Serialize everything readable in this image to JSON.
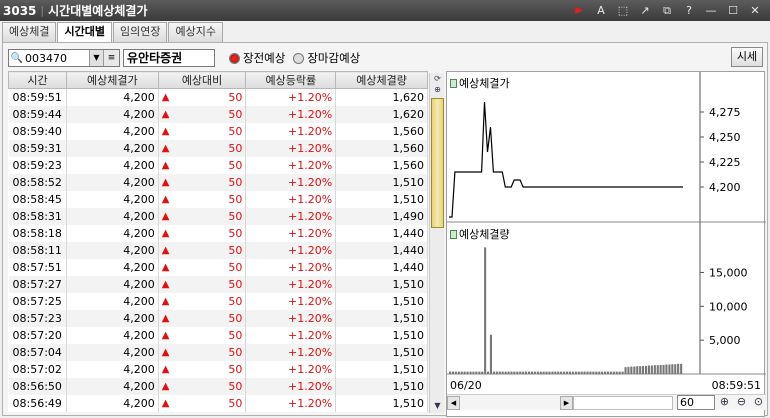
{
  "window": {
    "code": "3035",
    "title": "시간대별예상체결가"
  },
  "title_icons": [
    "play-icon",
    "font-icon",
    "pin-icon",
    "link-icon",
    "copy-icon",
    "help-icon",
    "minimize-icon",
    "maximize-icon",
    "close-icon"
  ],
  "title_icon_glyphs": [
    "▶",
    "A",
    "⬚",
    "↗",
    "⧉",
    "?",
    "—",
    "☐",
    "✕"
  ],
  "tabs": [
    "예상체결",
    "시간대별",
    "임의연장",
    "예상지수"
  ],
  "active_tab": 1,
  "controls": {
    "code_value": "003470",
    "stock_name": "유안타증권",
    "radio_pre": "장전예상",
    "radio_close": "장마감예상",
    "selected_radio": "pre",
    "sise_button": "시세"
  },
  "table": {
    "columns": [
      "시간",
      "예상체결가",
      "예상대비",
      "예상등락률",
      "예상체결량"
    ],
    "rows": [
      [
        "08:59:51",
        "4,200",
        "50",
        "+1.20%",
        "1,620"
      ],
      [
        "08:59:44",
        "4,200",
        "50",
        "+1.20%",
        "1,620"
      ],
      [
        "08:59:40",
        "4,200",
        "50",
        "+1.20%",
        "1,560"
      ],
      [
        "08:59:31",
        "4,200",
        "50",
        "+1.20%",
        "1,560"
      ],
      [
        "08:59:23",
        "4,200",
        "50",
        "+1.20%",
        "1,560"
      ],
      [
        "08:58:52",
        "4,200",
        "50",
        "+1.20%",
        "1,510"
      ],
      [
        "08:58:45",
        "4,200",
        "50",
        "+1.20%",
        "1,510"
      ],
      [
        "08:58:31",
        "4,200",
        "50",
        "+1.20%",
        "1,490"
      ],
      [
        "08:58:18",
        "4,200",
        "50",
        "+1.20%",
        "1,440"
      ],
      [
        "08:58:11",
        "4,200",
        "50",
        "+1.20%",
        "1,440"
      ],
      [
        "08:57:51",
        "4,200",
        "50",
        "+1.20%",
        "1,440"
      ],
      [
        "08:57:27",
        "4,200",
        "50",
        "+1.20%",
        "1,510"
      ],
      [
        "08:57:25",
        "4,200",
        "50",
        "+1.20%",
        "1,510"
      ],
      [
        "08:57:23",
        "4,200",
        "50",
        "+1.20%",
        "1,510"
      ],
      [
        "08:57:20",
        "4,200",
        "50",
        "+1.20%",
        "1,510"
      ],
      [
        "08:57:04",
        "4,200",
        "50",
        "+1.20%",
        "1,510"
      ],
      [
        "08:57:02",
        "4,200",
        "50",
        "+1.20%",
        "1,510"
      ],
      [
        "08:56:50",
        "4,200",
        "50",
        "+1.20%",
        "1,510"
      ],
      [
        "08:56:49",
        "4,200",
        "50",
        "+1.20%",
        "1,510"
      ]
    ]
  },
  "chart_data": [
    {
      "type": "line",
      "title": "예상체결가",
      "yticks": [
        "4,275",
        "4,250",
        "4,225",
        "4,200"
      ],
      "ylim": [
        4165,
        4295
      ],
      "values": [
        4170,
        4170,
        4215,
        4215,
        4215,
        4215,
        4215,
        4215,
        4215,
        4215,
        4215,
        4215,
        4285,
        4235,
        4260,
        4215,
        4215,
        4215,
        4215,
        4200,
        4200,
        4200,
        4207,
        4207,
        4207,
        4200,
        4200,
        4200,
        4200,
        4200,
        4200,
        4200,
        4200,
        4200,
        4200,
        4200,
        4200,
        4200,
        4200,
        4200,
        4200,
        4200,
        4200,
        4200,
        4200,
        4200,
        4200,
        4200,
        4200,
        4200,
        4200,
        4200,
        4200,
        4200,
        4200,
        4200,
        4200,
        4200,
        4200,
        4200,
        4200,
        4200,
        4200,
        4200,
        4200,
        4200,
        4200,
        4200,
        4200,
        4200,
        4200,
        4200,
        4200,
        4200,
        4200,
        4200,
        4200,
        4200,
        4200,
        4200
      ]
    },
    {
      "type": "bar",
      "title": "예상체결량",
      "yticks": [
        "15,000",
        "10,000",
        "5,000"
      ],
      "ylim": [
        0,
        19500
      ],
      "values": [
        350,
        350,
        350,
        350,
        350,
        350,
        350,
        350,
        350,
        350,
        350,
        350,
        18700,
        350,
        5800,
        350,
        350,
        350,
        350,
        350,
        350,
        350,
        350,
        350,
        350,
        350,
        350,
        350,
        350,
        350,
        350,
        350,
        350,
        350,
        350,
        350,
        350,
        350,
        350,
        350,
        350,
        350,
        350,
        350,
        350,
        350,
        350,
        350,
        350,
        350,
        350,
        350,
        350,
        350,
        350,
        350,
        350,
        350,
        350,
        350,
        1000,
        1050,
        1100,
        1100,
        1150,
        1150,
        1200,
        1200,
        1250,
        1250,
        1300,
        1300,
        1350,
        1350,
        1400,
        1400,
        1450,
        1450,
        1500,
        1500
      ],
      "x_start": "06/20",
      "x_end": "08:59:51"
    }
  ],
  "chart_controls": {
    "zoom_value": "60"
  },
  "colors": {
    "up": "#e01010",
    "accent_thumb": "#e8d27a"
  }
}
